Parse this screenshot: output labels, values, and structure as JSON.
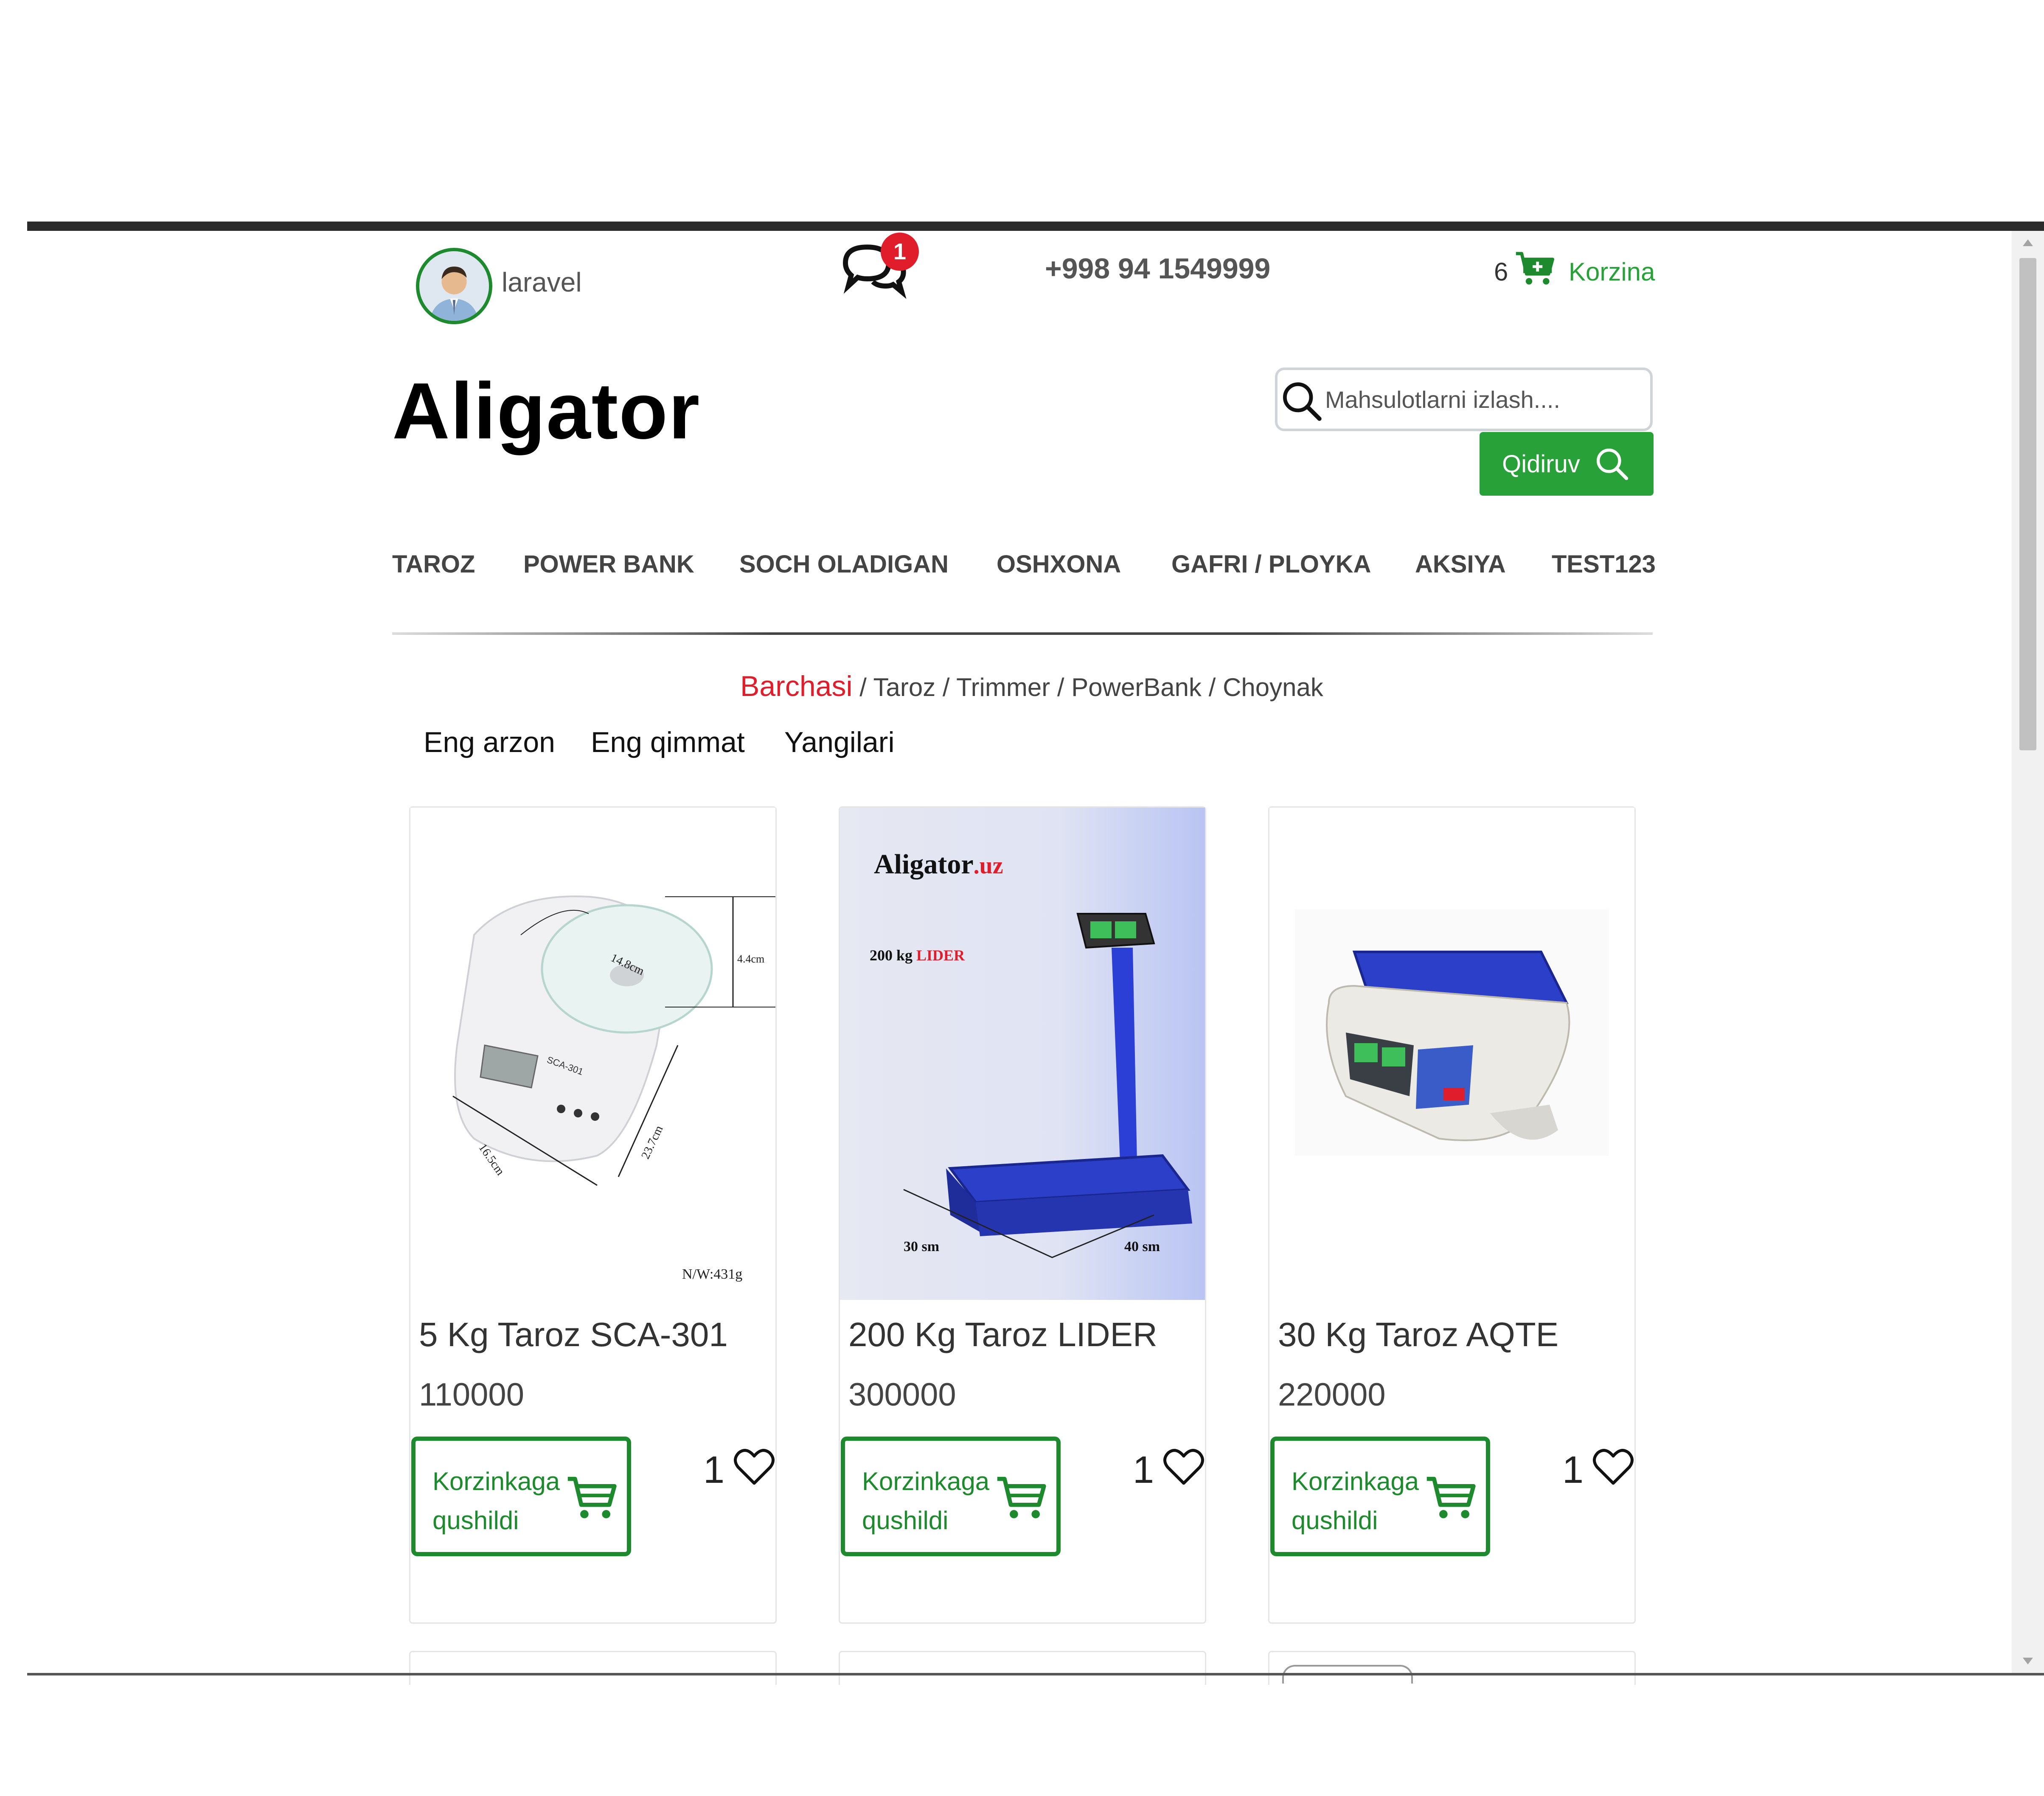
{
  "header": {
    "username": "laravel",
    "chat_badge": "1",
    "phone": "+998 94 1549999",
    "cart_count": "6",
    "cart_label": "Korzina"
  },
  "brand": {
    "logo": "Aligator"
  },
  "search": {
    "placeholder": "Mahsulotlarni izlash....",
    "value": "",
    "button_label": "Qidiruv"
  },
  "nav": {
    "items": [
      {
        "label": "TAROZ"
      },
      {
        "label": "POWER BANK"
      },
      {
        "label": "SOCH OLADIGAN"
      },
      {
        "label": "OSHXONA"
      },
      {
        "label": "GAFRI / PLOYKA"
      },
      {
        "label": "AKSIYA"
      },
      {
        "label": "TEST123"
      }
    ]
  },
  "breadcrumb": {
    "active": "Barchasi",
    "items": [
      "Taroz",
      "Trimmer",
      "PowerBank",
      "Choynak"
    ]
  },
  "sort": {
    "items": [
      "Eng arzon",
      "Eng qimmat",
      "Yangilari"
    ]
  },
  "products": [
    {
      "title": "5 Kg Taroz SCA-301",
      "price": "110000",
      "cart_button": "Korzinkaga qushildi",
      "likes": "1",
      "image_text": {
        "model": "SCA-301",
        "weight": "N/W:431g",
        "d1": "14.8cm",
        "d2": "4.4cm",
        "d3": "16.5cm",
        "d4": "23.7cm"
      }
    },
    {
      "title": "200 Kg Taroz LIDER",
      "price": "300000",
      "cart_button": "Korzinkaga qushildi",
      "likes": "1",
      "image_text": {
        "brand": "Aligator",
        "brand_tld": ".uz",
        "cap": "200 kg",
        "cap_name": "LIDER",
        "w": "30 sm",
        "l": "40 sm"
      }
    },
    {
      "title": "30 Kg Taroz AQTE",
      "price": "220000",
      "cart_button": "Korzinkaga qushildi",
      "likes": "1"
    }
  ],
  "colors": {
    "accent_green": "#28a138",
    "border_green": "#1e8a2e",
    "badge_red": "#e01d2b",
    "active_breadcrumb": "#e01d2b"
  },
  "icons": {
    "chat": "chat-bubbles-icon",
    "cart": "cart-plus-icon",
    "search": "search-icon",
    "heart": "heart-icon"
  }
}
